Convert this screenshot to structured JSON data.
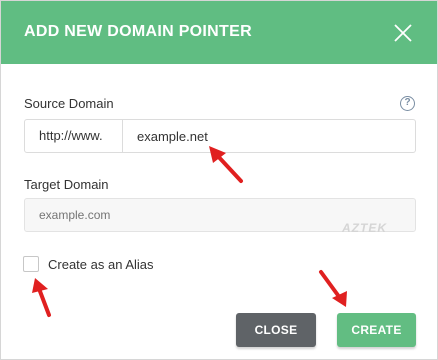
{
  "dialog": {
    "title": "ADD NEW DOMAIN POINTER",
    "close_icon": "close-icon",
    "colors": {
      "header": "#60bd82",
      "create_button": "#62bd82",
      "close_button": "#5f6367",
      "annotation_arrow": "#e02020"
    }
  },
  "source_domain": {
    "label": "Source Domain",
    "help_icon": "question-circle-icon",
    "help_glyph": "?",
    "prefix": "http://www.",
    "value": "example.net"
  },
  "target_domain": {
    "label": "Target Domain",
    "placeholder": "example.com"
  },
  "alias": {
    "label": "Create as an Alias",
    "checked": false
  },
  "buttons": {
    "close": "CLOSE",
    "create": "CREATE"
  },
  "watermark": "AZTEK"
}
